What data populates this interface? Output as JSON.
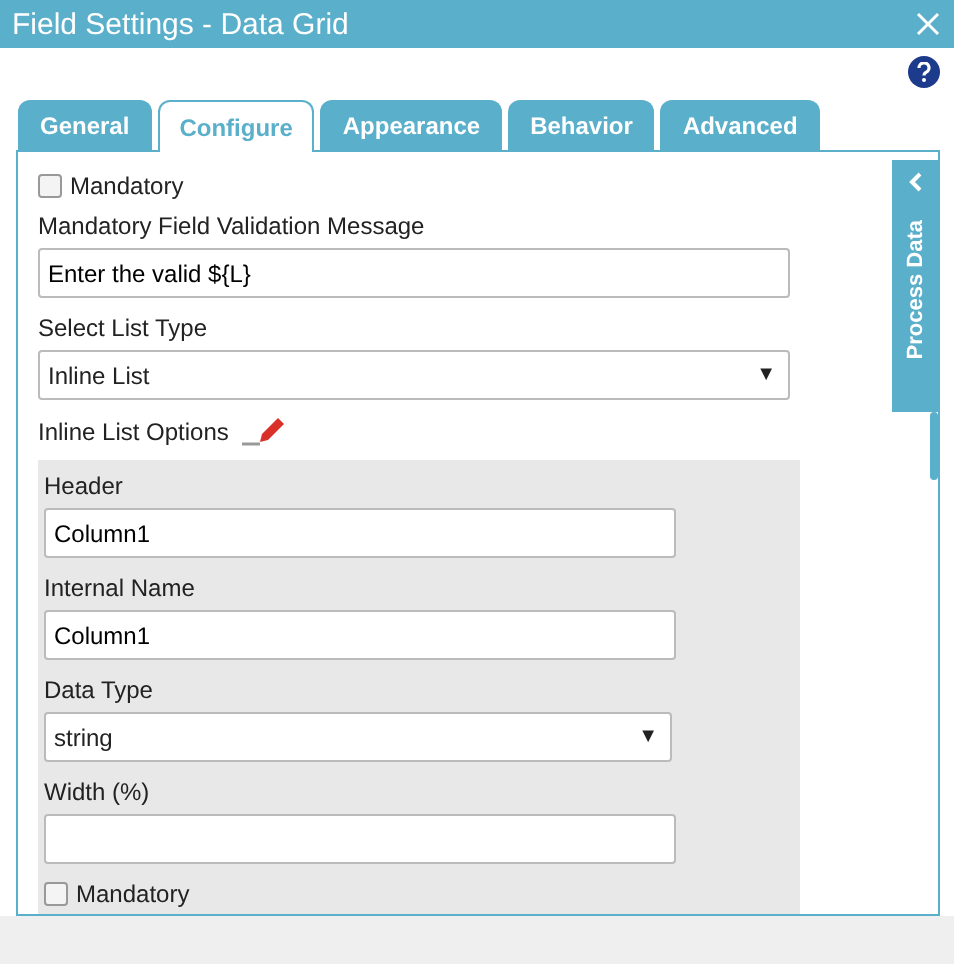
{
  "window": {
    "title": "Field Settings - Data Grid"
  },
  "tabs": [
    {
      "label": "General",
      "selected": false
    },
    {
      "label": "Configure",
      "selected": true
    },
    {
      "label": "Appearance",
      "selected": false
    },
    {
      "label": "Behavior",
      "selected": false
    },
    {
      "label": "Advanced",
      "selected": false
    }
  ],
  "mandatory": {
    "label": "Mandatory",
    "checked": false
  },
  "validation_message": {
    "label": "Mandatory Field Validation Message",
    "value": "Enter the valid ${L}"
  },
  "list_type": {
    "label": "Select List Type",
    "value": "Inline List",
    "caret": "▼"
  },
  "inline_list_options": {
    "label": "Inline List Options",
    "fields": [
      {
        "kind": "text",
        "label": "Header",
        "value": "Column1"
      },
      {
        "kind": "text",
        "label": "Internal Name",
        "value": "Column1"
      },
      {
        "kind": "select",
        "label": "Data Type",
        "value": "string",
        "caret": "▼"
      },
      {
        "kind": "text",
        "label": "Width (%)"
      },
      {
        "kind": "checkbox",
        "label": "Mandatory",
        "checked": false
      }
    ]
  },
  "side_panel": {
    "label": "Process Data"
  }
}
